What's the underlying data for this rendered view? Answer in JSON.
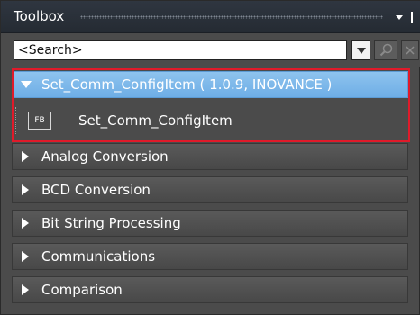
{
  "window": {
    "title": "Toolbox"
  },
  "search": {
    "value": "<Search>"
  },
  "tree": {
    "expanded_group": {
      "label": "Set_Comm_ConfigItem ( 1.0.9, INOVANCE )"
    },
    "fb_item": {
      "icon_text": "FB",
      "label": "Set_Comm_ConfigItem"
    },
    "groups": [
      {
        "label": "Analog Conversion"
      },
      {
        "label": "BCD Conversion"
      },
      {
        "label": "Bit String Processing"
      },
      {
        "label": "Communications"
      },
      {
        "label": "Comparison"
      }
    ]
  },
  "colors": {
    "selected_group": "#7ab8ea",
    "highlight_border": "#e01a2a",
    "panel_background": "#4b4b4b"
  },
  "icons": [
    "dropdown-arrow-icon",
    "pin-icon",
    "search-icon",
    "clear-icon",
    "expand-arrow-icon",
    "collapse-arrow-icon",
    "function-block-icon"
  ]
}
